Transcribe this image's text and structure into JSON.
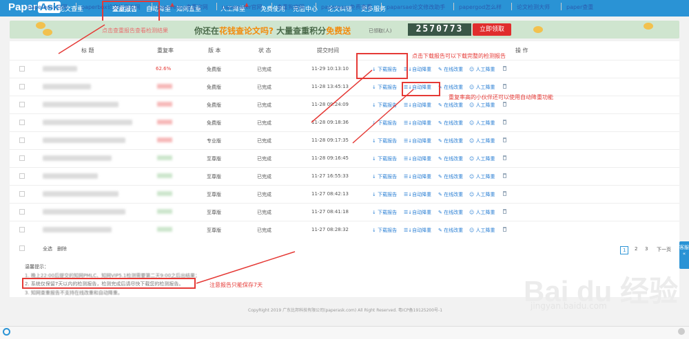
{
  "nav": {
    "logo_text": "Paper",
    "logo_box": "Ask",
    "items": [
      "论文查重",
      "查重报告",
      "自动降重",
      "知网查重",
      "人工降重",
      "免费使用",
      "充值中心",
      "论文纠错",
      "更多服务"
    ]
  },
  "banner": {
    "annotation": "点击查重报告查看检测结果",
    "main_pre": "你还在",
    "main_hl1": "花钱查论文吗?",
    "main_mid": " 大量查重积分",
    "main_hl2": "免费送",
    "claimed_label": "已领取(人)",
    "counter": "2570773",
    "claim_button": "立即领取"
  },
  "table": {
    "headers": [
      "标 题",
      "重复率",
      "版 本",
      "状 态",
      "提交时间",
      "操 作"
    ],
    "rows": [
      {
        "rate": "62.6%",
        "version": "免费版",
        "status": "已完成",
        "time": "11-29 10:13:10"
      },
      {
        "rate": "",
        "version": "免费版",
        "status": "已完成",
        "time": "11-28 13:45:13"
      },
      {
        "rate": "",
        "version": "免费版",
        "status": "已完成",
        "time": "11-28 09:24:09"
      },
      {
        "rate": "",
        "version": "免费版",
        "status": "已完成",
        "time": "11-28 09:18:36"
      },
      {
        "rate": "",
        "version": "专业版",
        "status": "已完成",
        "time": "11-28 09:17:35"
      },
      {
        "rate": "",
        "version": "至尊版",
        "status": "已完成",
        "time": "11-28 09:16:45"
      },
      {
        "rate": "",
        "version": "至尊版",
        "status": "已完成",
        "time": "11-27 16:55:33"
      },
      {
        "rate": "",
        "version": "至尊版",
        "status": "已完成",
        "time": "11-27 08:42:13"
      },
      {
        "rate": "",
        "version": "至尊版",
        "status": "已完成",
        "time": "11-27 08:41:18"
      },
      {
        "rate": "",
        "version": "至尊版",
        "status": "已完成",
        "time": "11-27 08:28:32"
      }
    ],
    "ops": [
      "下载报告",
      "自动降重",
      "在线改重",
      "人工降重"
    ],
    "select_all": "全选",
    "delete": "删除",
    "pages": [
      "1",
      "2",
      "3",
      "下一页"
    ]
  },
  "notes": {
    "download": "点击下载报告可以下载完整的检测报告",
    "auto": "重复率高的小伙伴还可以使用自动降重功能",
    "keep": "注意报告只能保存7天"
  },
  "tips": {
    "title": "温馨提示：",
    "t1": "1. 晚上22:00后提交的知网PMLC、知网VIP5.1检测需要第二天9:00之后出结果；",
    "t2": "2. 系统仅保留7天以内的检测报告，检测完成后请尽快下载您的检测报告。",
    "t3": "3. 知网查重报告不支持在线改重和自动降重。"
  },
  "copyright": "CopyRight 2019 广东比邦科技有限公司(paperask.com) All Right Reserved. 粤ICP备19125200号-1",
  "side_tab": "客服",
  "bottom_links": [
    "papereasy官网",
    "paperbox论文检测官网",
    "papereasy查重官网",
    "paperrater官网",
    "查重狗官网",
    "papereasy免费查重",
    "paparsae论文修改助手",
    "papergod怎么样",
    "论文检测大师",
    "paper查重"
  ],
  "watermark": "Bai du 经验",
  "watermark_url": "jingyan.baidu.com"
}
